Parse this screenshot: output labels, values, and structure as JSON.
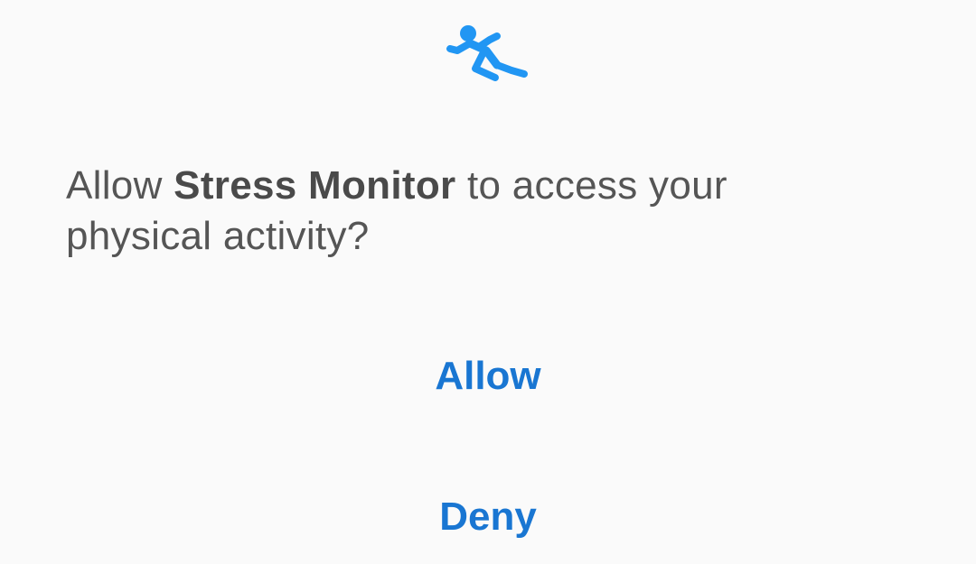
{
  "dialog": {
    "icon": "physical-activity-icon",
    "message_prefix": "Allow ",
    "app_name": "Stress Monitor",
    "message_suffix": " to access your physical activity?",
    "allow_label": "Allow",
    "deny_label": "Deny"
  },
  "colors": {
    "accent": "#1976d2",
    "icon": "#2196f3",
    "text": "#555555",
    "background": "#fafafa"
  }
}
